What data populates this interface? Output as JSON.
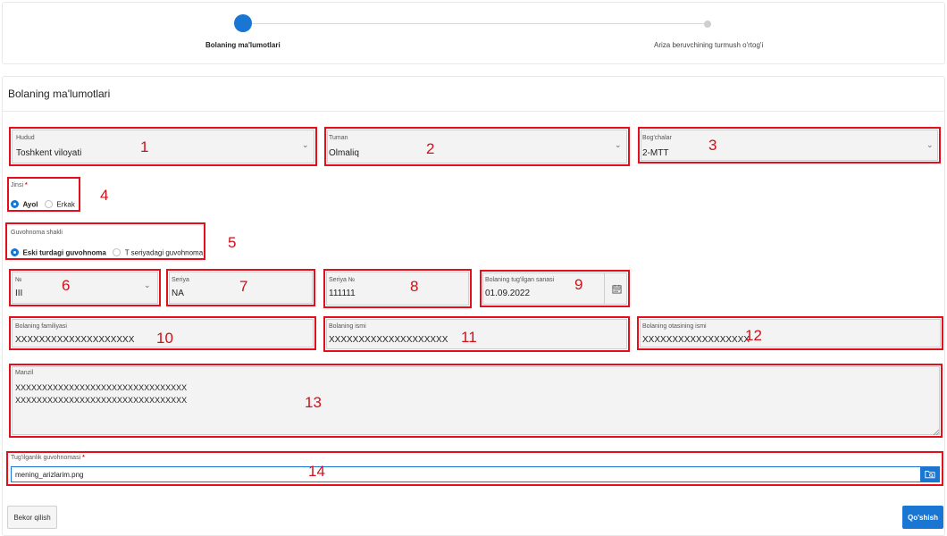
{
  "stepper": {
    "step1": "Bolaning ma'lumotlari",
    "step2": "Ariza beruvchining turmush o'rtog'i"
  },
  "section_title": "Bolaning ma'lumotlari",
  "fields": {
    "hudud": {
      "label": "Hudud",
      "value": "Toshkent viloyati",
      "marker": "1"
    },
    "tuman": {
      "label": "Tuman",
      "value": "Olmaliq",
      "marker": "2"
    },
    "bogcha": {
      "label": "Bog'chalar",
      "value": "2-MTT",
      "marker": "3"
    },
    "jinsi": {
      "label": "Jinsi",
      "required": "*",
      "opt_female": "Ayol",
      "opt_male": "Erkak",
      "marker": "4"
    },
    "guvohnoma": {
      "label": "Guvohnoma shakli",
      "opt_old": "Eski turdagi guvohnoma",
      "opt_new": "T seriyadagi guvohnoma",
      "marker": "5"
    },
    "number": {
      "label": "№",
      "value": "III",
      "marker": "6"
    },
    "seriya": {
      "label": "Seriya",
      "value": "NA",
      "marker": "7"
    },
    "seriya_no": {
      "label": "Seriya №",
      "value": "111111",
      "marker": "8"
    },
    "birth_date": {
      "label": "Bolaning tug'ilgan sanasi",
      "value": "01.09.2022",
      "marker": "9"
    },
    "familiya": {
      "label": "Bolaning familiyasi",
      "value": "XXXXXXXXXXXXXXXXXXXX",
      "marker": "10"
    },
    "ism": {
      "label": "Bolaning ismi",
      "value": "XXXXXXXXXXXXXXXXXXXX",
      "marker": "11"
    },
    "otasining_ismi": {
      "label": "Bolaning otasining ismi",
      "value": "XXXXXXXXXXXXXXXXXX",
      "marker": "12"
    },
    "manzil": {
      "label": "Manzil",
      "line1": "XXXXXXXXXXXXXXXXXXXXXXXXXXXXXXXX",
      "line2": "XXXXXXXXXXXXXXXXXXXXXXXXXXXXXXXX",
      "marker": "13"
    },
    "certificate": {
      "label": "Tug'ilganlik guvohnomasi",
      "required": "*",
      "value": "mening_arizlarim.png",
      "marker": "14"
    }
  },
  "buttons": {
    "cancel": "Bekor qilish",
    "submit": "Qo'shish"
  },
  "colors": {
    "primary": "#1976d2",
    "highlight": "#e3101b"
  },
  "icons": {
    "dropdown": "chevron-down-icon",
    "calendar": "calendar-icon",
    "file": "folder-search-icon"
  }
}
